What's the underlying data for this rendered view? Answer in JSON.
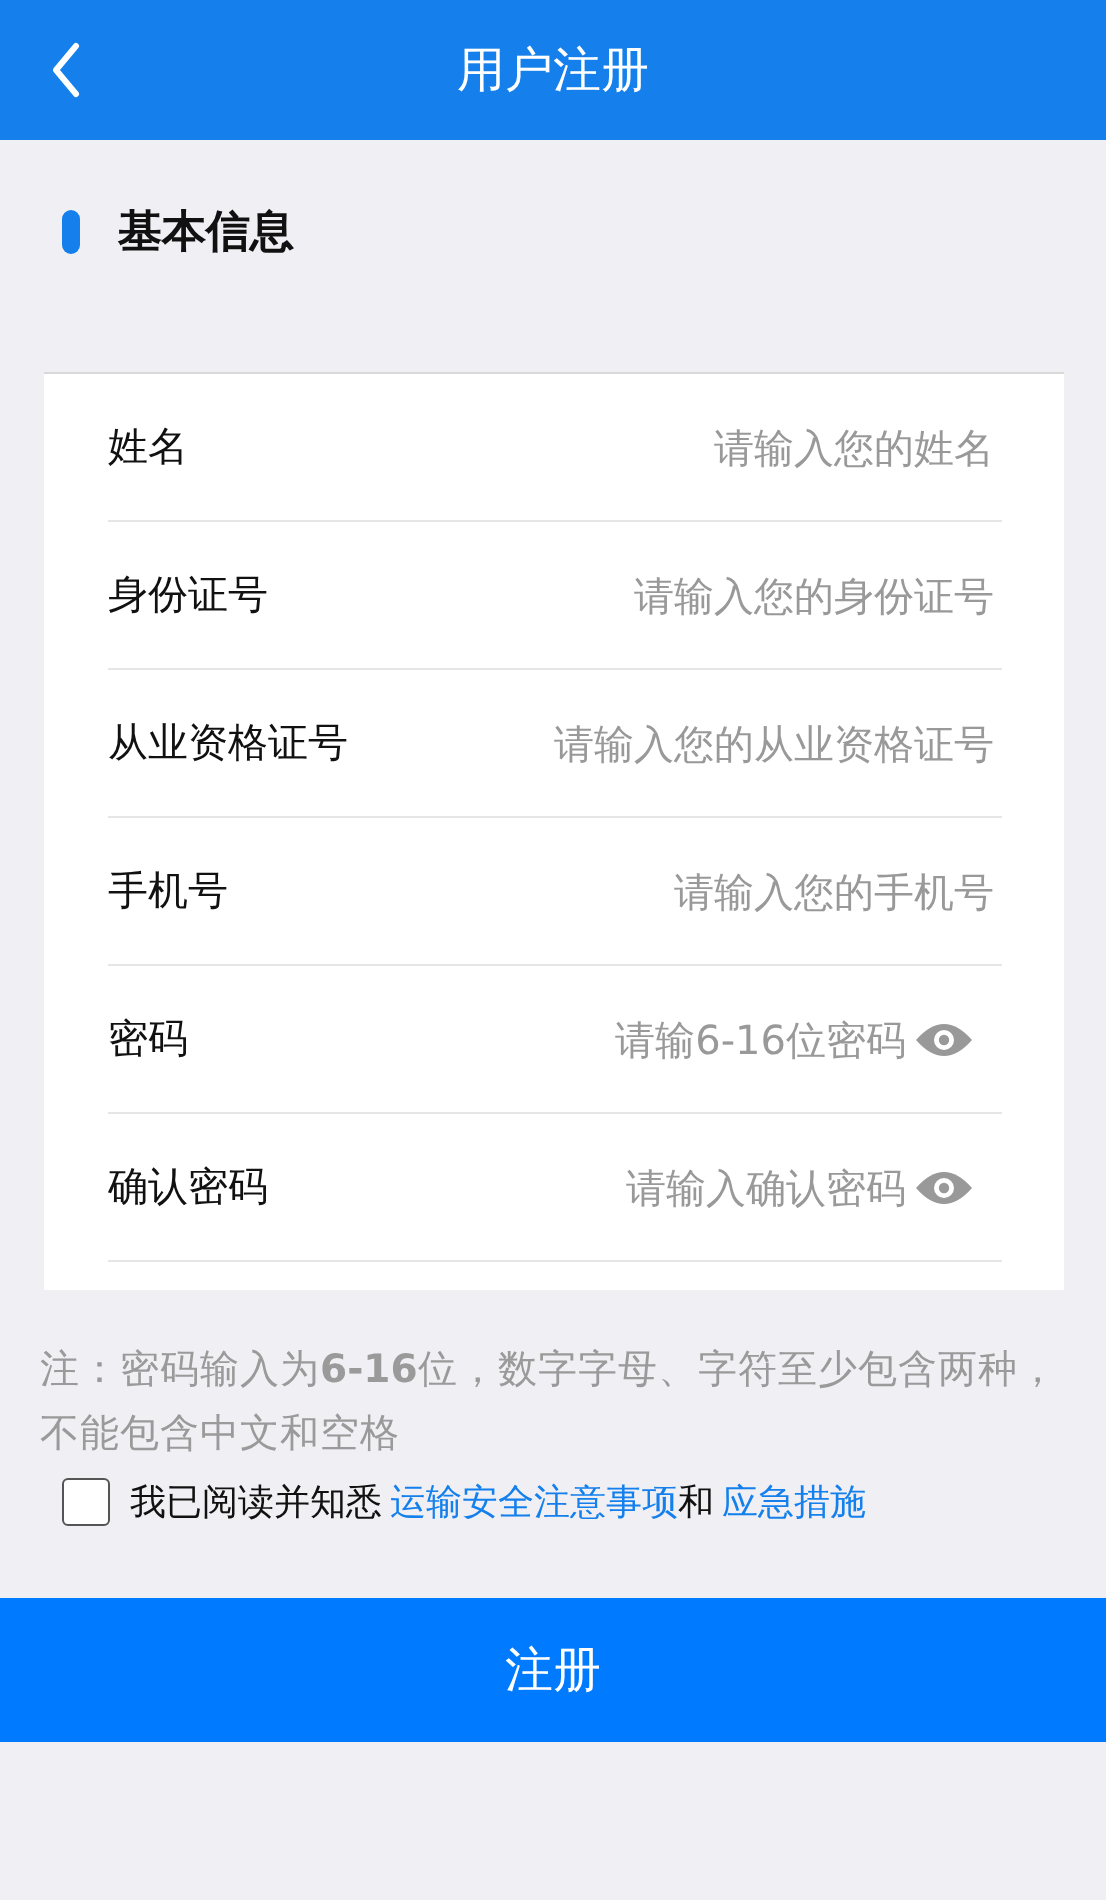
{
  "header": {
    "title": "用户注册"
  },
  "section": {
    "title": "基本信息"
  },
  "fields": [
    {
      "label": "姓名",
      "placeholder": "请输入您的姓名",
      "kind": "text"
    },
    {
      "label": "身份证号",
      "placeholder": "请输入您的身份证号",
      "kind": "text"
    },
    {
      "label": "从业资格证号",
      "placeholder": "请输入您的从业资格证号",
      "kind": "text"
    },
    {
      "label": "手机号",
      "placeholder": "请输入您的手机号",
      "kind": "text"
    },
    {
      "label": "密码",
      "placeholder": "请输6-16位密码",
      "kind": "password"
    },
    {
      "label": "确认密码",
      "placeholder": "请输入确认密码",
      "kind": "password"
    }
  ],
  "note": "注：密码输入为**6-16**位，数字字母、字符至少包含两种，不能包含中文和空格",
  "agreement": {
    "checked": false,
    "parts": [
      {
        "kind": "text",
        "text": "我已阅读并知悉"
      },
      {
        "kind": "link",
        "text": "运输安全注意事项"
      },
      {
        "kind": "text",
        "text": "和"
      },
      {
        "kind": "link",
        "text": "应急措施"
      }
    ]
  },
  "submit": "注册"
}
